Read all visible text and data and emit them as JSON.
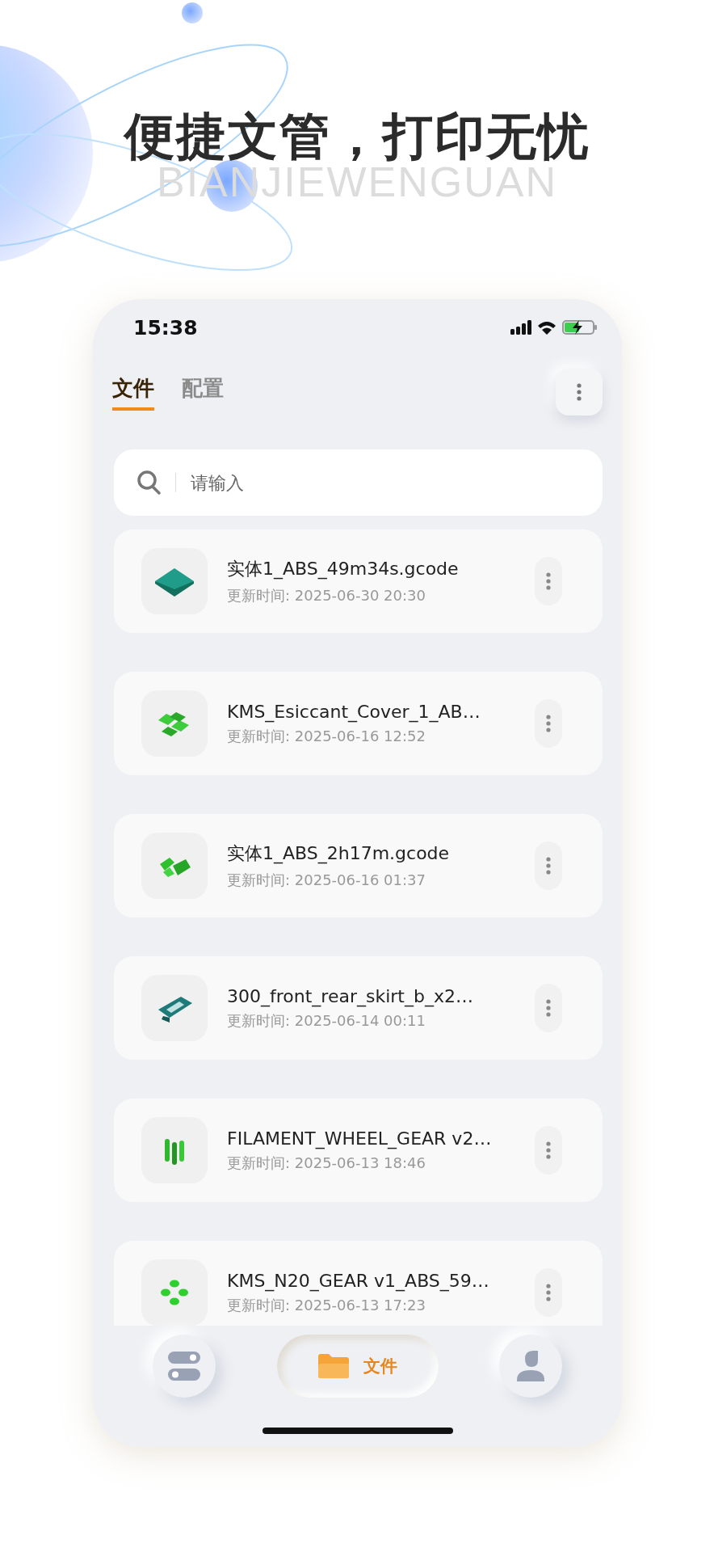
{
  "headline": "便捷文管，打印无忧",
  "subtitle": "BIANJIEWENGUAN",
  "status_bar": {
    "time": "15:38"
  },
  "tabs": [
    {
      "label": "文件",
      "selected": true
    },
    {
      "label": "配置",
      "selected": false
    }
  ],
  "search": {
    "placeholder": "请输入"
  },
  "files": [
    {
      "name": "实体1_ABS_49m34s.gcode",
      "updated": "更新时间: 2025-06-30 20:30"
    },
    {
      "name": "KMS_Esiccant_Cover_1_AB…",
      "updated": "更新时间: 2025-06-16 12:52"
    },
    {
      "name": "实体1_ABS_2h17m.gcode",
      "updated": "更新时间: 2025-06-16 01:37"
    },
    {
      "name": "300_front_rear_skirt_b_x2…",
      "updated": "更新时间: 2025-06-14 00:11"
    },
    {
      "name": "FILAMENT_WHEEL_GEAR v2…",
      "updated": "更新时间: 2025-06-13 18:46"
    },
    {
      "name": "KMS_N20_GEAR v1_ABS_59…",
      "updated": "更新时间: 2025-06-13 17:23"
    }
  ],
  "bottom_nav": [
    {
      "kind": "settings",
      "selected": false
    },
    {
      "kind": "files",
      "label": "文件",
      "selected": true
    },
    {
      "kind": "profile",
      "selected": false
    }
  ]
}
